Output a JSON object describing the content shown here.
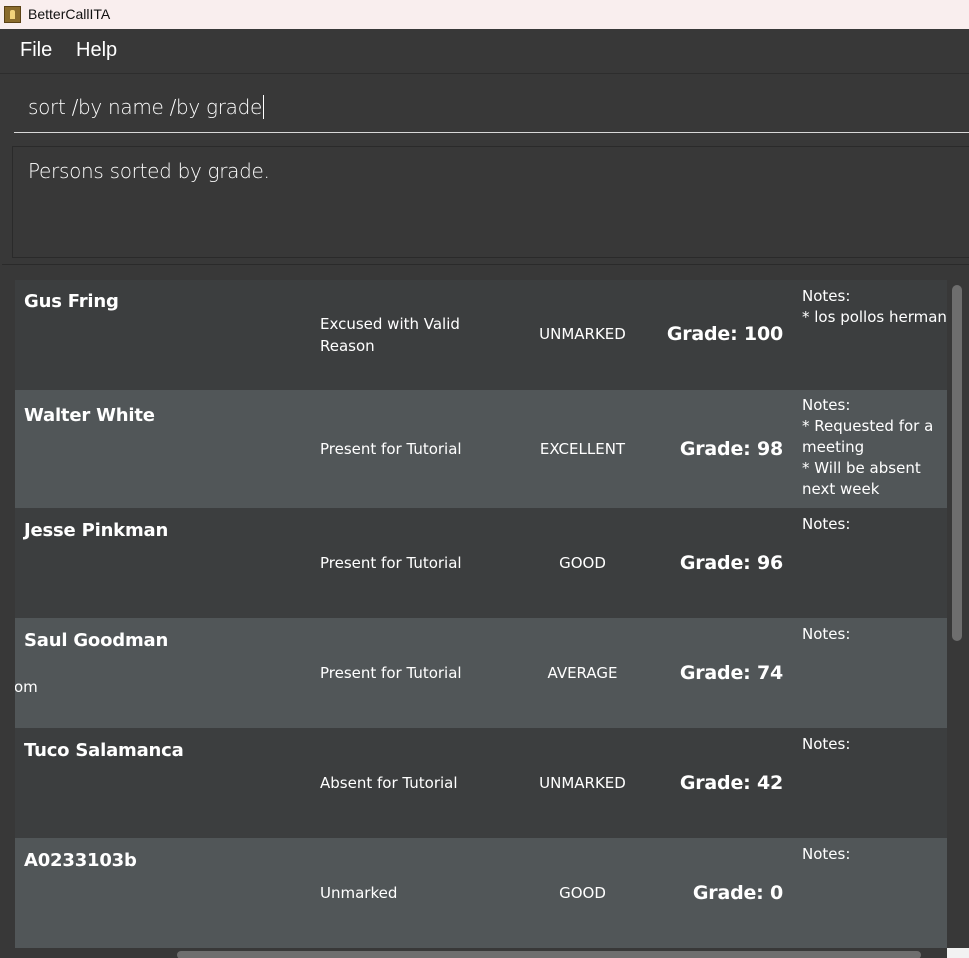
{
  "window": {
    "title": "BetterCallITA"
  },
  "menu": {
    "items": [
      "File",
      "Help"
    ]
  },
  "command_box": {
    "value": "sort /by name /by grade"
  },
  "result_display": {
    "text": "Persons sorted by grade."
  },
  "persons": [
    {
      "name": "Gus Fring",
      "attendance": "Excused with Valid Reason",
      "participation": "UNMARKED",
      "grade": "Grade: 100",
      "notes_label": "Notes:",
      "notes": [
        "* los pollos hermanos"
      ]
    },
    {
      "name": "Walter White",
      "attendance": "Present for Tutorial",
      "participation": "EXCELLENT",
      "grade": "Grade: 98",
      "notes_label": "Notes:",
      "notes": [
        "* Requested for a meeting",
        "* Will be absent next week"
      ]
    },
    {
      "name": "Jesse Pinkman",
      "attendance": "Present for Tutorial",
      "participation": "GOOD",
      "grade": "Grade: 96",
      "notes_label": "Notes:",
      "notes": []
    },
    {
      "name": "Saul Goodman",
      "attendance": "Present for Tutorial",
      "participation": "AVERAGE",
      "grade": "Grade: 74",
      "notes_label": "Notes:",
      "notes": [],
      "fragment": "om"
    },
    {
      "name": "Tuco Salamanca",
      "attendance": "Absent for Tutorial",
      "participation": "UNMARKED",
      "grade": "Grade: 42",
      "notes_label": "Notes:",
      "notes": []
    },
    {
      "name": "A0233103b",
      "attendance": "Unmarked",
      "participation": "GOOD",
      "grade": "Grade: 0",
      "notes_label": "Notes:",
      "notes": []
    }
  ]
}
